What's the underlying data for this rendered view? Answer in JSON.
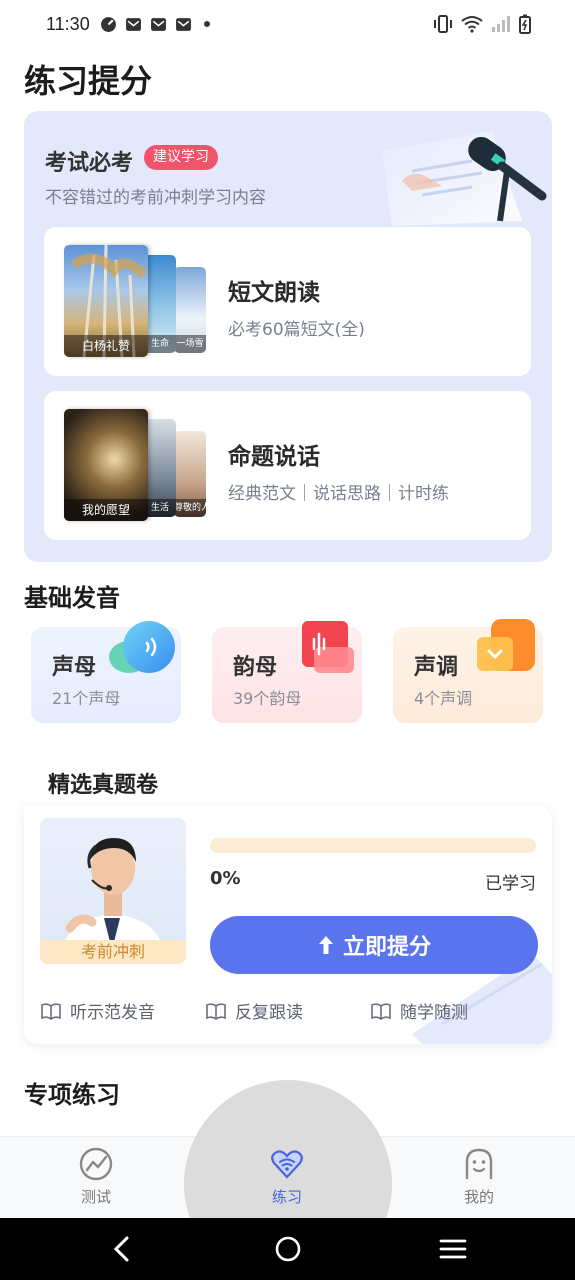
{
  "status_bar": {
    "time": "11:30"
  },
  "page": {
    "title": "练习提分"
  },
  "exam_section": {
    "title": "考试必考",
    "badge": "建议学习",
    "subtitle": "不容错过的考前冲刺学习内容",
    "cards": [
      {
        "title": "短文朗读",
        "subtitle": "必考60篇短文(全)",
        "thumbs": [
          "白杨礼赞",
          "生命",
          "一场雪"
        ]
      },
      {
        "title": "命题说话",
        "subtitle": "经典范文｜说话思路｜计时练",
        "thumbs": [
          "我的愿望",
          "生活",
          "尊敬的人"
        ]
      }
    ]
  },
  "basic_section": {
    "title": "基础发音",
    "tiles": [
      {
        "name": "声母",
        "count": "21个声母"
      },
      {
        "name": "韵母",
        "count": "39个韵母"
      },
      {
        "name": "声调",
        "count": "4个声调"
      }
    ]
  },
  "papers_section": {
    "title": "精选真题卷",
    "teacher_tag": "考前冲刺",
    "progress": 0,
    "progress_text": "0%",
    "progress_label": "已学习",
    "button_label": "立即提分",
    "features": [
      "听示范发音",
      "反复跟读",
      "随学随测"
    ]
  },
  "special_section": {
    "title": "专项练习"
  },
  "bottom_nav": [
    {
      "label": "测试",
      "icon": "chart-line-icon"
    },
    {
      "label": "练习",
      "icon": "practice-heart-icon"
    },
    {
      "label": "我的",
      "icon": "profile-icon"
    }
  ],
  "colors": {
    "accent": "#5a74ee",
    "badge": "#f0546a",
    "progress": "#f3a13c"
  }
}
